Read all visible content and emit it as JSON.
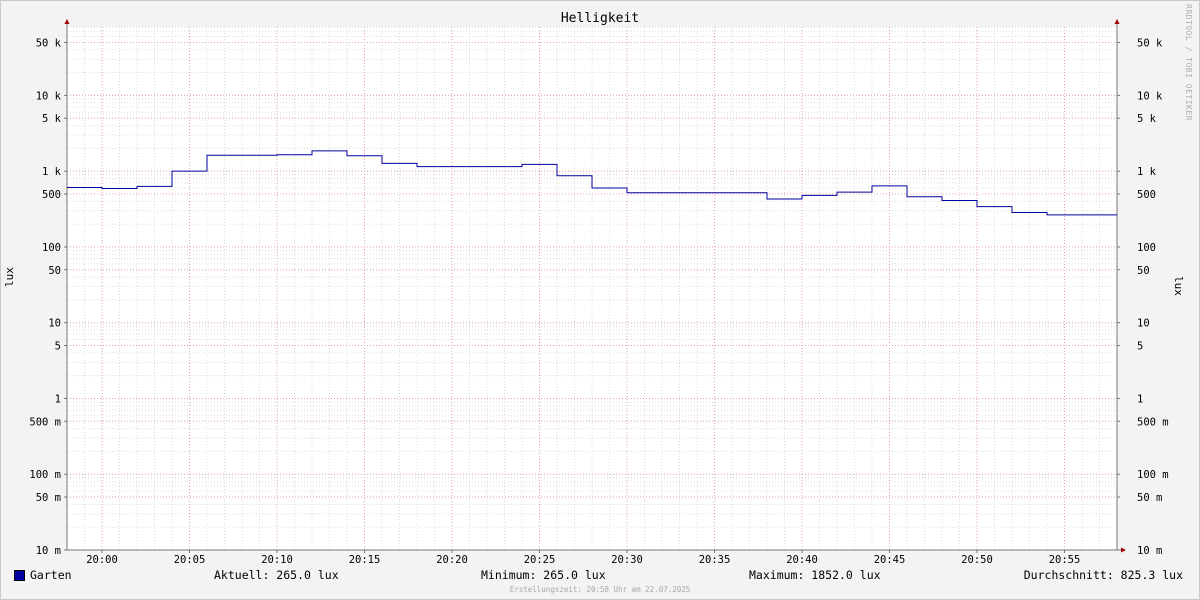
{
  "title": "Helligkeit",
  "watermark": "RRDTOOL / TOBI OETIKER",
  "y_axis_label": "lux",
  "legend": {
    "series_name": "Garten",
    "swatch_color": "#0000a0",
    "current": "Aktuell: 265.0 lux",
    "minimum": "Minimum: 265.0 lux",
    "maximum": "Maximum: 1852.0 lux",
    "average": "Durchschnitt: 825.3 lux"
  },
  "footer": "Erstellungszeit: 20:58 Uhr am 22.07.2025",
  "chart_data": {
    "type": "line",
    "title": "Helligkeit",
    "ylabel": "lux",
    "y_scale": "log",
    "ylim": [
      0.01,
      80000
    ],
    "xlim": [
      "19:58",
      "20:58"
    ],
    "grid": true,
    "legend_position": "bottom",
    "y_ticks": [
      {
        "value": 50000,
        "label": "50 k"
      },
      {
        "value": 10000,
        "label": "10 k"
      },
      {
        "value": 5000,
        "label": "5 k"
      },
      {
        "value": 1000,
        "label": "1 k"
      },
      {
        "value": 500,
        "label": "500"
      },
      {
        "value": 100,
        "label": "100"
      },
      {
        "value": 50,
        "label": "50"
      },
      {
        "value": 10,
        "label": "10"
      },
      {
        "value": 5,
        "label": "5"
      },
      {
        "value": 1,
        "label": "1"
      },
      {
        "value": 0.5,
        "label": "500 m"
      },
      {
        "value": 0.1,
        "label": "100 m"
      },
      {
        "value": 0.05,
        "label": "50 m"
      },
      {
        "value": 0.01,
        "label": "10 m"
      }
    ],
    "x_ticks": [
      "20:00",
      "20:05",
      "20:10",
      "20:15",
      "20:20",
      "20:25",
      "20:30",
      "20:35",
      "20:40",
      "20:45",
      "20:50",
      "20:55"
    ],
    "series": [
      {
        "name": "Garten",
        "color": "#0000a0",
        "step": true,
        "x": [
          "19:58",
          "20:00",
          "20:02",
          "20:04",
          "20:06",
          "20:10",
          "20:12",
          "20:14",
          "20:16",
          "20:18",
          "20:24",
          "20:26",
          "20:28",
          "20:30",
          "20:38",
          "20:40",
          "20:42",
          "20:44",
          "20:46",
          "20:48",
          "20:50",
          "20:52",
          "20:54",
          "20:58"
        ],
        "values": [
          610,
          590,
          630,
          1000,
          1620,
          1650,
          1852,
          1600,
          1270,
          1150,
          1230,
          870,
          600,
          520,
          430,
          480,
          530,
          640,
          460,
          410,
          340,
          285,
          265,
          265
        ]
      }
    ]
  }
}
